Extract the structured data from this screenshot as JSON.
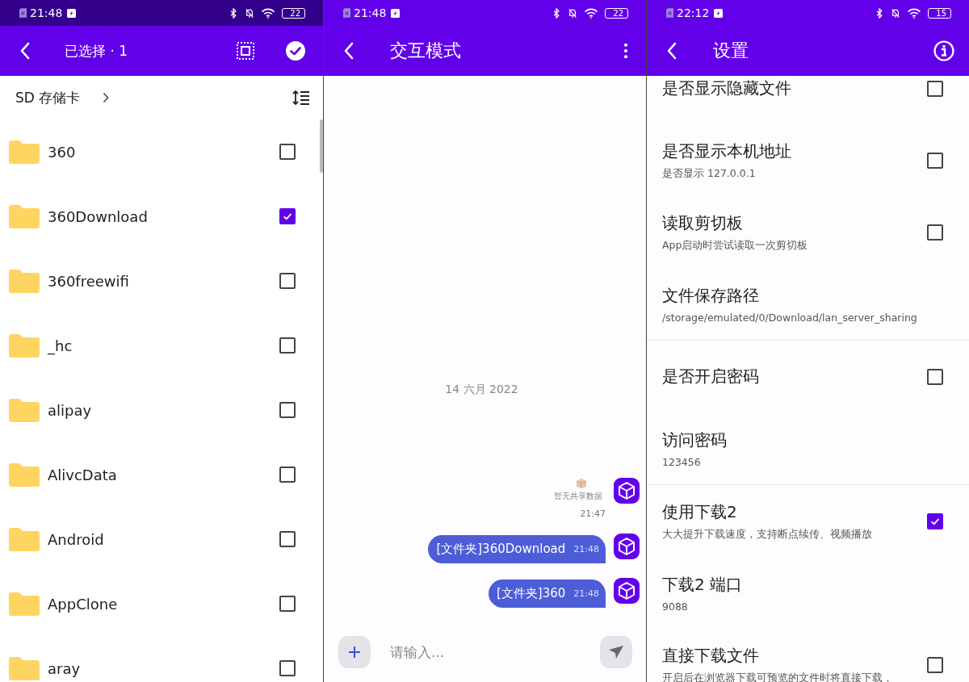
{
  "file_picker": {
    "status_bar": {
      "time": "21:48",
      "battery": "22"
    },
    "app_bar": {
      "title": "已选择 · 1"
    },
    "path": {
      "label": "SD 存储卡"
    },
    "folders": [
      {
        "name": "360",
        "checked": false
      },
      {
        "name": "360Download",
        "checked": true
      },
      {
        "name": "360freewifi",
        "checked": false
      },
      {
        "name": "_hc",
        "checked": false
      },
      {
        "name": "alipay",
        "checked": false
      },
      {
        "name": "AlivcData",
        "checked": false
      },
      {
        "name": "Android",
        "checked": false
      },
      {
        "name": "AppClone",
        "checked": false
      },
      {
        "name": "aray",
        "checked": false
      }
    ]
  },
  "chat": {
    "status_bar": {
      "time": "21:48",
      "battery": "22"
    },
    "app_bar": {
      "title": "交互模式"
    },
    "date": "14 六月 2022",
    "messages": [
      {
        "kind": "empty",
        "text": "暂无共享数据",
        "time": "21:47"
      },
      {
        "kind": "bubble",
        "text": "[文件夹]360Download",
        "time": "21:48"
      },
      {
        "kind": "bubble",
        "text": "[文件夹]360",
        "time": "21:48"
      }
    ],
    "input": {
      "placeholder": "请输入..."
    }
  },
  "settings": {
    "status_bar": {
      "time": "22:12",
      "battery": "15"
    },
    "app_bar": {
      "title": "设置"
    },
    "groups": [
      {
        "items": [
          {
            "kind": "checkbox",
            "title": "是否显示隐藏文件",
            "checked": false
          },
          {
            "kind": "checkbox",
            "title": "是否显示本机地址",
            "subtitle": "是否显示 127.0.0.1",
            "checked": false
          },
          {
            "kind": "checkbox",
            "title": "读取剪切板",
            "subtitle": "App启动时尝试读取一次剪切板",
            "checked": false
          },
          {
            "kind": "text",
            "title": "文件保存路径",
            "subtitle": "/storage/emulated/0/Download/lan_server_sharing"
          }
        ]
      },
      {
        "items": [
          {
            "kind": "checkbox",
            "title": "是否开启密码",
            "checked": false
          },
          {
            "kind": "text",
            "title": "访问密码",
            "subtitle": "123456"
          }
        ]
      },
      {
        "items": [
          {
            "kind": "checkbox",
            "title": "使用下载2",
            "subtitle": "大大提升下载速度，支持断点续传、视频播放",
            "checked": true
          },
          {
            "kind": "text",
            "title": "下载2 端口",
            "subtitle": "9088"
          },
          {
            "kind": "checkbox",
            "title": "直接下载文件",
            "subtitle": "开启后在浏览器下载可预览的文件时将直接下载，",
            "checked": false
          }
        ]
      }
    ]
  }
}
